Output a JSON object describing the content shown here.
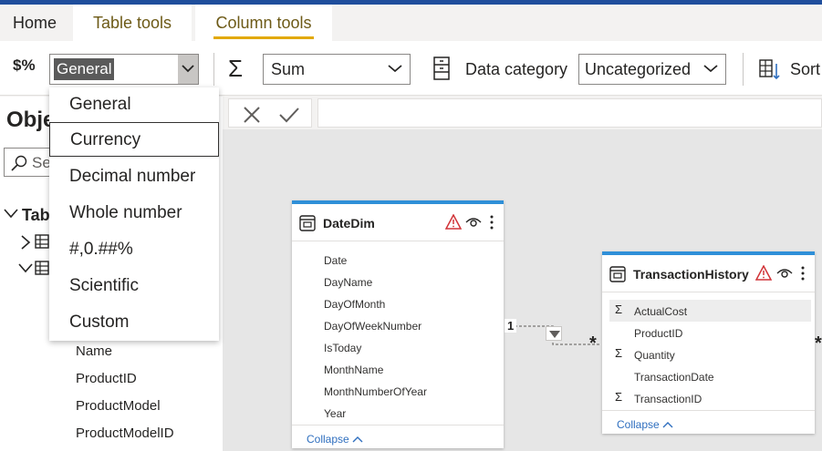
{
  "tabs": {
    "home": "Home",
    "table_tools": "Table tools",
    "column_tools": "Column tools"
  },
  "ribbon": {
    "format_icon": "$%",
    "format_value": "General",
    "sigma": "Σ",
    "summarization_value": "Sum",
    "data_category_label": "Data category",
    "data_category_value": "Uncategorized",
    "sort_label": "Sort"
  },
  "format_dropdown": {
    "options": [
      "General",
      "Currency",
      "Decimal number",
      "Whole number",
      "#,0.##%",
      "Scientific",
      "Custom"
    ],
    "focused_index": 1
  },
  "left_panel": {
    "title_partial": "Obje",
    "search_partial": "Se",
    "tree_partial": "Tab",
    "fields": [
      "Name",
      "ProductID",
      "ProductModel",
      "ProductModelID"
    ]
  },
  "date_dim": {
    "title": "DateDim",
    "fields": [
      "Date",
      "DayName",
      "DayOfMonth",
      "DayOfWeekNumber",
      "IsToday",
      "MonthName",
      "MonthNumberOfYear",
      "Year"
    ],
    "collapse": "Collapse"
  },
  "transaction_history": {
    "title": "TransactionHistory",
    "fields": [
      {
        "name": "ActualCost",
        "sigma": "Σ"
      },
      {
        "name": "ProductID",
        "sigma": ""
      },
      {
        "name": "Quantity",
        "sigma": "Σ"
      },
      {
        "name": "TransactionDate",
        "sigma": ""
      },
      {
        "name": "TransactionID",
        "sigma": "Σ"
      }
    ],
    "collapse": "Collapse"
  },
  "relationship": {
    "one_label": "1",
    "many_label": "*",
    "many_label_right": "*"
  },
  "colors": {
    "accent_blue": "#1f4e9c",
    "card_border": "#2f8fd8",
    "tab_underline": "#e2a900",
    "warning": "#d13438"
  }
}
